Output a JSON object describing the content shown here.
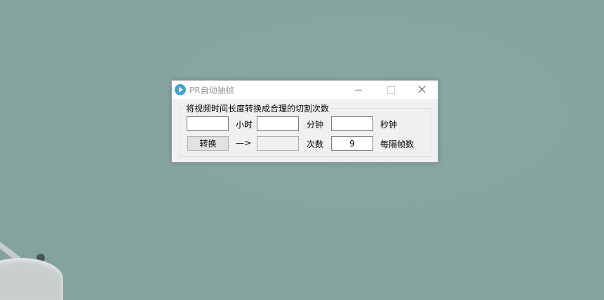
{
  "window": {
    "title": "PR自动抽帧",
    "app_icon": "play-icon"
  },
  "titlebar_buttons": {
    "minimize": "minimize-icon",
    "maximize": "maximize-icon",
    "close": "close-icon"
  },
  "group": {
    "legend": "将视频时间长度转换成合理的切割次数"
  },
  "inputs": {
    "hours": {
      "value": "",
      "unit": "小时"
    },
    "minutes": {
      "value": "",
      "unit": "分钟"
    },
    "seconds": {
      "value": "",
      "unit": "秒钟"
    },
    "result": {
      "value": "",
      "unit": "次数"
    },
    "interval_frames": {
      "value": "9",
      "unit": "每隔帧数"
    }
  },
  "convert_button": "转换",
  "arrow": "—>",
  "colors": {
    "desktop": "#84a29e",
    "window_bg": "#f0f0f0",
    "app_icon": "#3ba3d8"
  }
}
